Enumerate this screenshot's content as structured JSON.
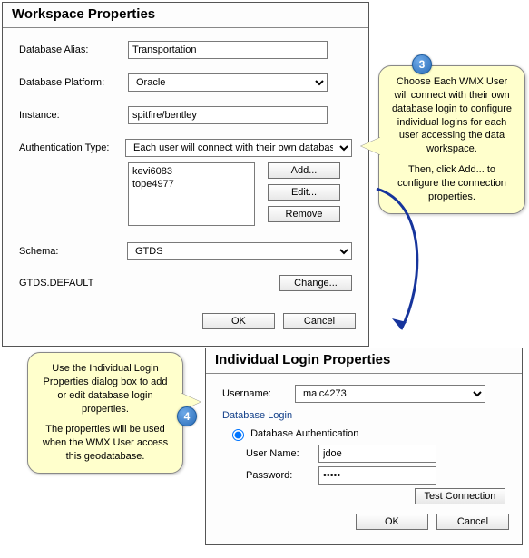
{
  "workspace": {
    "title": "Workspace Properties",
    "labels": {
      "database_alias": "Database Alias:",
      "database_platform": "Database Platform:",
      "instance": "Instance:",
      "authentication_type": "Authentication Type:",
      "schema": "Schema:",
      "gtds_default": "GTDS.DEFAULT"
    },
    "values": {
      "database_alias": "Transportation",
      "database_platform": "Oracle",
      "instance": "spitfire/bentley",
      "authentication_type": "Each user will connect with their own database login",
      "schema": "GTDS"
    },
    "userList": [
      "kevi6083",
      "tope4977"
    ],
    "buttons": {
      "add": "Add...",
      "edit": "Edit...",
      "remove": "Remove",
      "change": "Change...",
      "ok": "OK",
      "cancel": "Cancel"
    }
  },
  "individual": {
    "title": "Individual Login Properties",
    "labels": {
      "username": "Username:",
      "group": "Database Login",
      "db_auth": "Database Authentication",
      "user_name": "User Name:",
      "password": "Password:"
    },
    "values": {
      "username": "malc4273",
      "user_name": "jdoe",
      "password": "•••••"
    },
    "buttons": {
      "test": "Test Connection",
      "ok": "OK",
      "cancel": "Cancel"
    }
  },
  "callouts": {
    "c3": {
      "badge": "3",
      "text1": "Choose Each WMX User will connect with their own database login to configure individual logins for each user accessing the data workspace.",
      "text2": "Then, click Add... to configure the connection properties."
    },
    "c4": {
      "badge": "4",
      "text1": "Use the Individual Login Properties dialog box to add or edit database login properties.",
      "text2": "The properties will be used when the WMX User access this geodatabase."
    }
  }
}
